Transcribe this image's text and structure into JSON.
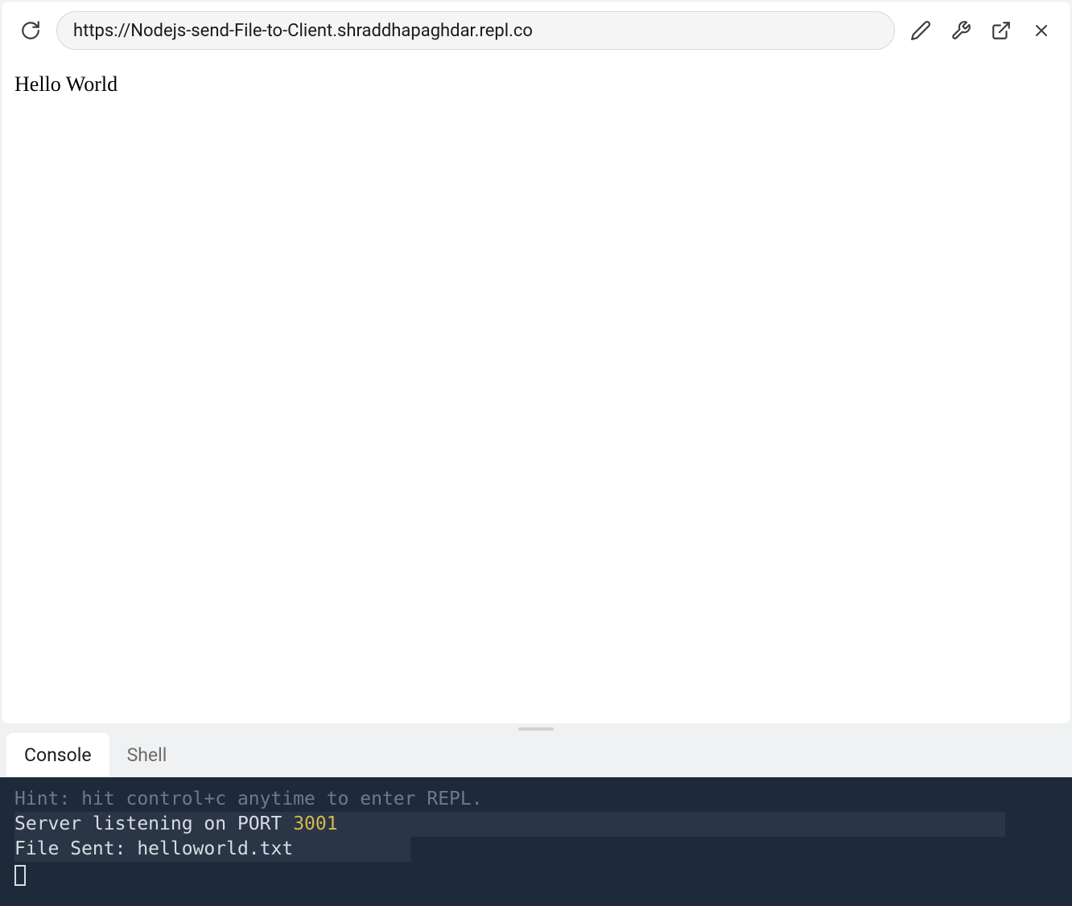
{
  "toolbar": {
    "url": "https://Nodejs-send-File-to-Client.shraddhapaghdar.repl.co"
  },
  "page": {
    "body_text": "Hello World"
  },
  "bottom_panel": {
    "tabs": [
      {
        "label": "Console",
        "active": true
      },
      {
        "label": "Shell",
        "active": false
      }
    ],
    "console": {
      "hint": "Hint: hit control+c anytime to enter REPL.",
      "line2_prefix": "Server listening on PORT ",
      "line2_port": "3001",
      "line3": "File Sent: helloworld.txt"
    }
  }
}
